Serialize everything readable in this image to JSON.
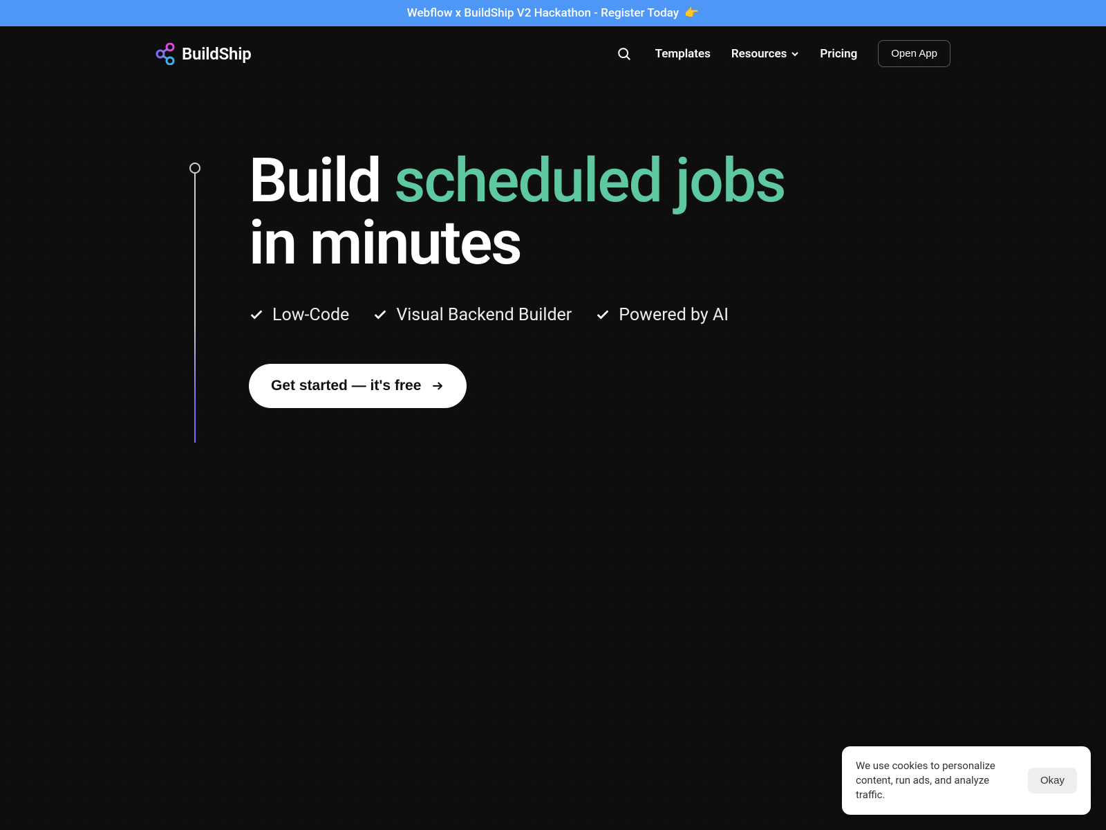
{
  "announcement": {
    "text": "Webflow x BuildShip V2 Hackathon - Register Today",
    "emoji": "👉"
  },
  "brand": {
    "name": "BuildShip"
  },
  "nav": {
    "templates": "Templates",
    "resources": "Resources",
    "pricing": "Pricing",
    "open_app": "Open App"
  },
  "hero": {
    "title_prefix": "Build",
    "title_accent": "scheduled jobs",
    "title_suffix": "in minutes",
    "features": [
      "Low-Code",
      "Visual Backend Builder",
      "Powered by AI"
    ],
    "cta": "Get started — it's free"
  },
  "cookie": {
    "text": "We use cookies to personalize content, run ads, and analyze traffic.",
    "ok": "Okay"
  },
  "colors": {
    "accent_green": "#5ec9a0",
    "banner_blue": "#4f97f7"
  }
}
